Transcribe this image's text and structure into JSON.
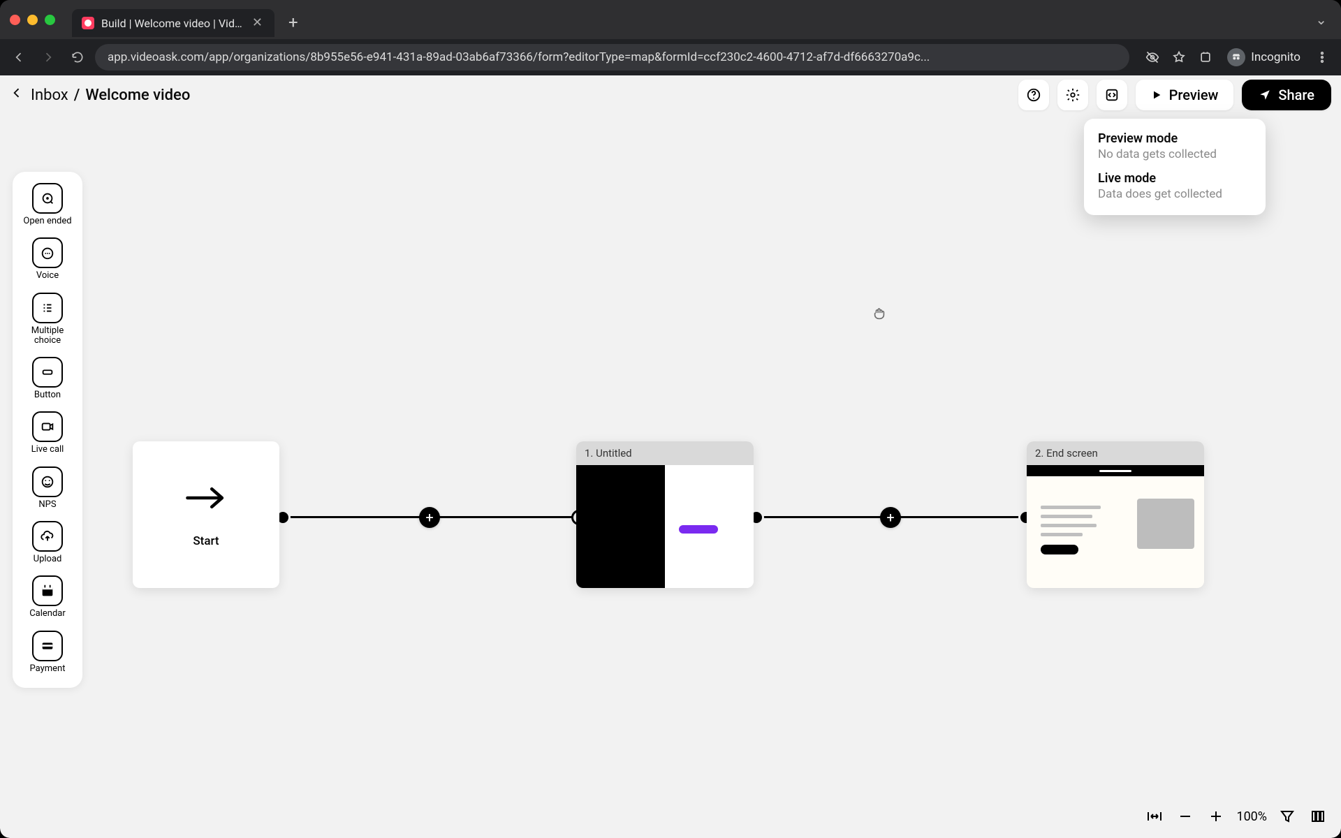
{
  "browser": {
    "tab_title": "Build | Welcome video | VideoA",
    "url": "app.videoask.com/app/organizations/8b955e56-e941-431a-89ad-03ab6af73366/form?editorType=map&formId=ccf230c2-4600-4712-af7d-df6663270a9c...",
    "incognito_label": "Incognito"
  },
  "header": {
    "back_label": "Inbox",
    "separator": "/",
    "title": "Welcome video",
    "preview_label": "Preview",
    "share_label": "Share"
  },
  "dropdown": {
    "preview_title": "Preview mode",
    "preview_sub": "No data gets collected",
    "live_title": "Live mode",
    "live_sub": "Data does get collected"
  },
  "palette": [
    {
      "id": "open-ended",
      "label": "Open ended"
    },
    {
      "id": "voice",
      "label": "Voice"
    },
    {
      "id": "multiple-choice",
      "label": "Multiple choice"
    },
    {
      "id": "button",
      "label": "Button"
    },
    {
      "id": "live-call",
      "label": "Live call"
    },
    {
      "id": "nps",
      "label": "NPS"
    },
    {
      "id": "upload",
      "label": "Upload"
    },
    {
      "id": "calendar",
      "label": "Calendar"
    },
    {
      "id": "payment",
      "label": "Payment"
    }
  ],
  "flow": {
    "start_label": "Start",
    "step1_title": "1. Untitled",
    "step2_title": "2. End screen"
  },
  "zoom": {
    "percent": "100%"
  }
}
